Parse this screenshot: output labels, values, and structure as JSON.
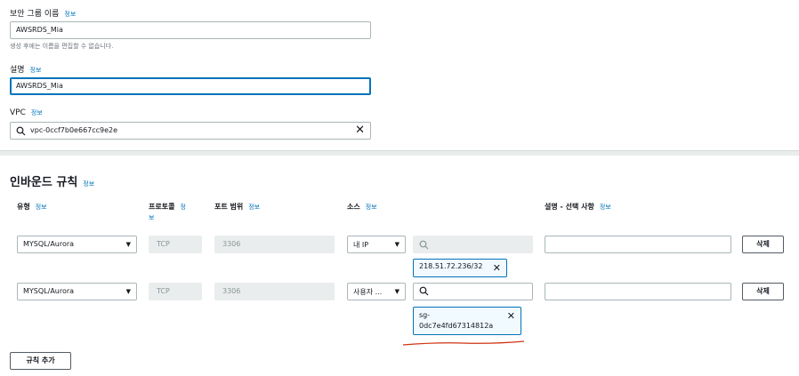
{
  "info_label": "정보",
  "form": {
    "sg_name_label": "보안 그룹 이름",
    "sg_name_value": "AWSRDS_Mia",
    "sg_name_hint": "생성 후에는 이름을 편집할 수 없습니다.",
    "desc_label": "설명",
    "desc_value": "AWSRDS_Mia",
    "vpc_label": "VPC",
    "vpc_value": "vpc-0ccf7b0e667cc9e2e"
  },
  "inbound": {
    "title": "인바운드 규칙",
    "headers": {
      "type": "유형",
      "protocol_a": "프로토콜",
      "protocol_info_a": "정",
      "protocol_info_b": "보",
      "port": "포트 범위",
      "source": "소스",
      "description": "설명 - 선택 사항"
    },
    "rules": [
      {
        "type": "MYSQL/Aurora",
        "protocol": "TCP",
        "port": "3306",
        "source": "내 IP",
        "token": "218.51.72.236/32",
        "delete": "삭제"
      },
      {
        "type": "MYSQL/Aurora",
        "protocol": "TCP",
        "port": "3306",
        "source": "사용자 ...",
        "token_line1": "sg-",
        "token_line2": "0dc7e4fd67314812a",
        "delete": "삭제"
      }
    ],
    "add_rule": "규칙 추가"
  },
  "colors": {
    "accent": "#0073bb",
    "annotation": "#d13212"
  }
}
